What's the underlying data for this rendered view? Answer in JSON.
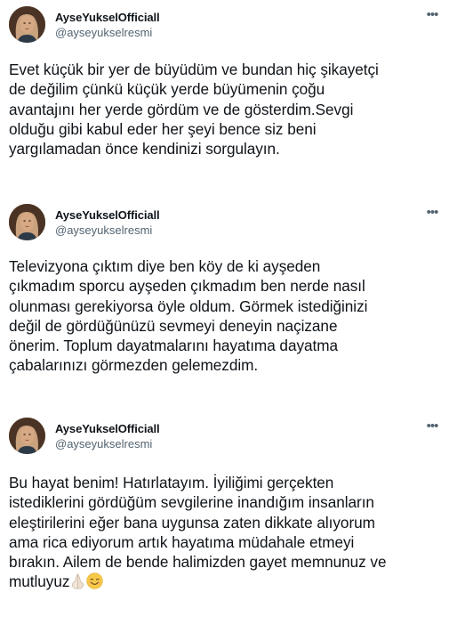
{
  "tweets": [
    {
      "display_name": "AyseYukselOfficiall",
      "handle": "@ayseyukselresmi",
      "more_label": "•••",
      "text": "Evet küçük bir yer de büyüdüm ve bundan hiç şikayetçi\nde değilim çünkü küçük yerde büyümenin çoğu\navantajını her yerde gördüm ve de gösterdim.Sevgi\nolduğu gibi kabul eder her şeyi bence siz beni\nyargılamadan önce kendinizi sorgulayın."
    },
    {
      "display_name": "AyseYukselOfficiall",
      "handle": "@ayseyukselresmi",
      "more_label": "•••",
      "text": "Televizyona çıktım diye ben köy de ki ayşeden\nçıkmadım sporcu ayşeden çıkmadım ben nerde nasıl\nolunması gerekiyorsa öyle oldum. Görmek istediğinizi\ndeğil de gördüğünüzü sevmeyi deneyin naçizane\nönerim. Toplum dayatmalarını hayatıma dayatma\nçabalarınızı görmezden gelemezdim."
    },
    {
      "display_name": "AyseYukselOfficiall",
      "handle": "@ayseyukselresmi",
      "more_label": "•••",
      "text": "Bu hayat benim! Hatırlatayım. İyiliğimi gerçekten\nistediklerini gördüğüm sevgilerine inandığım insanların\neleştirilerini eğer bana uygunsa zaten dikkate alıyorum\nama rica ediyorum artık hayatıma müdahale etmeyi\nbırakın. Ailem de bende halimizden gayet memnunuz ve\nmutluyuz",
      "emojis": [
        "folded-hands-emoji",
        "smiling-face-emoji"
      ]
    }
  ]
}
